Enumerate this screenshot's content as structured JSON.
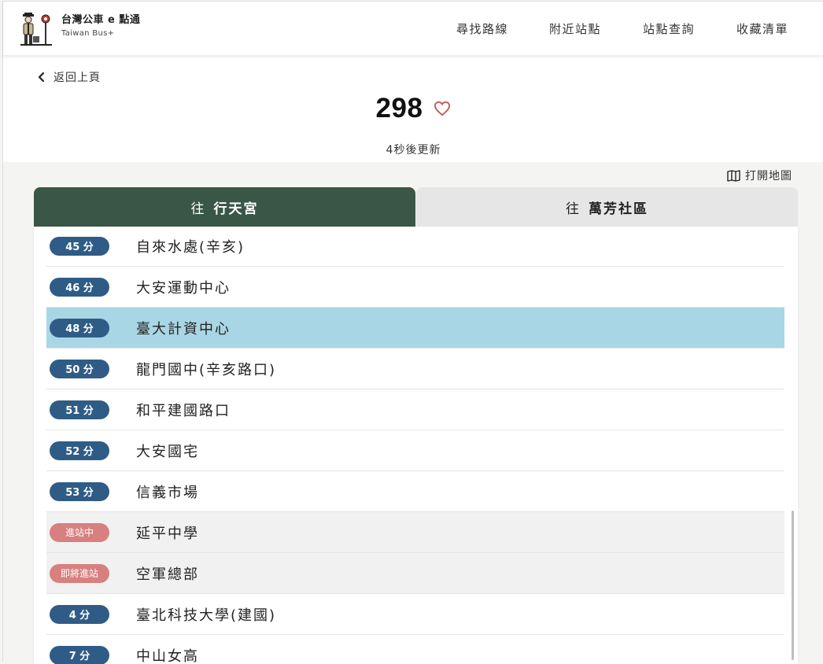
{
  "header": {
    "brand_title": "台灣公車 e 點通",
    "brand_subtitle": "Taiwan Bus+",
    "nav": [
      "尋找路線",
      "附近站點",
      "站點查詢",
      "收藏清單"
    ]
  },
  "route": {
    "back_label": "返回上頁",
    "number": "298",
    "countdown": "4秒後更新",
    "map_label": "打開地圖"
  },
  "tabs": [
    {
      "prefix": "往",
      "destination": "行天宮",
      "active": true
    },
    {
      "prefix": "往",
      "destination": "萬芳社區",
      "active": false
    }
  ],
  "stops": [
    {
      "eta": "45 分",
      "name": "自來水處(辛亥)",
      "state": "scheduled"
    },
    {
      "eta": "46 分",
      "name": "大安運動中心",
      "state": "scheduled"
    },
    {
      "eta": "48 分",
      "name": "臺大計資中心",
      "state": "scheduled",
      "highlighted": true
    },
    {
      "eta": "50 分",
      "name": "龍門國中(辛亥路口)",
      "state": "scheduled"
    },
    {
      "eta": "51 分",
      "name": "和平建國路口",
      "state": "scheduled"
    },
    {
      "eta": "52 分",
      "name": "大安國宅",
      "state": "scheduled"
    },
    {
      "eta": "53 分",
      "name": "信義市場",
      "state": "scheduled"
    },
    {
      "eta": "進站中",
      "name": "延平中學",
      "state": "arriving"
    },
    {
      "eta": "即將進站",
      "name": "空軍總部",
      "state": "approaching"
    },
    {
      "eta": "4 分",
      "name": "臺北科技大學(建國)",
      "state": "scheduled"
    },
    {
      "eta": "7 分",
      "name": "中山女高",
      "state": "scheduled"
    }
  ],
  "colors": {
    "brand_dark_green": "#3a5647",
    "badge_blue": "#2f5c86",
    "badge_red": "#d7807f",
    "highlight_blue": "#a9d6e4",
    "heart_red": "#c0584e"
  },
  "icons": {
    "logo": "bus-driver-logo",
    "back": "chevron-left-icon",
    "favorite": "heart-outline-icon",
    "map": "map-icon"
  }
}
